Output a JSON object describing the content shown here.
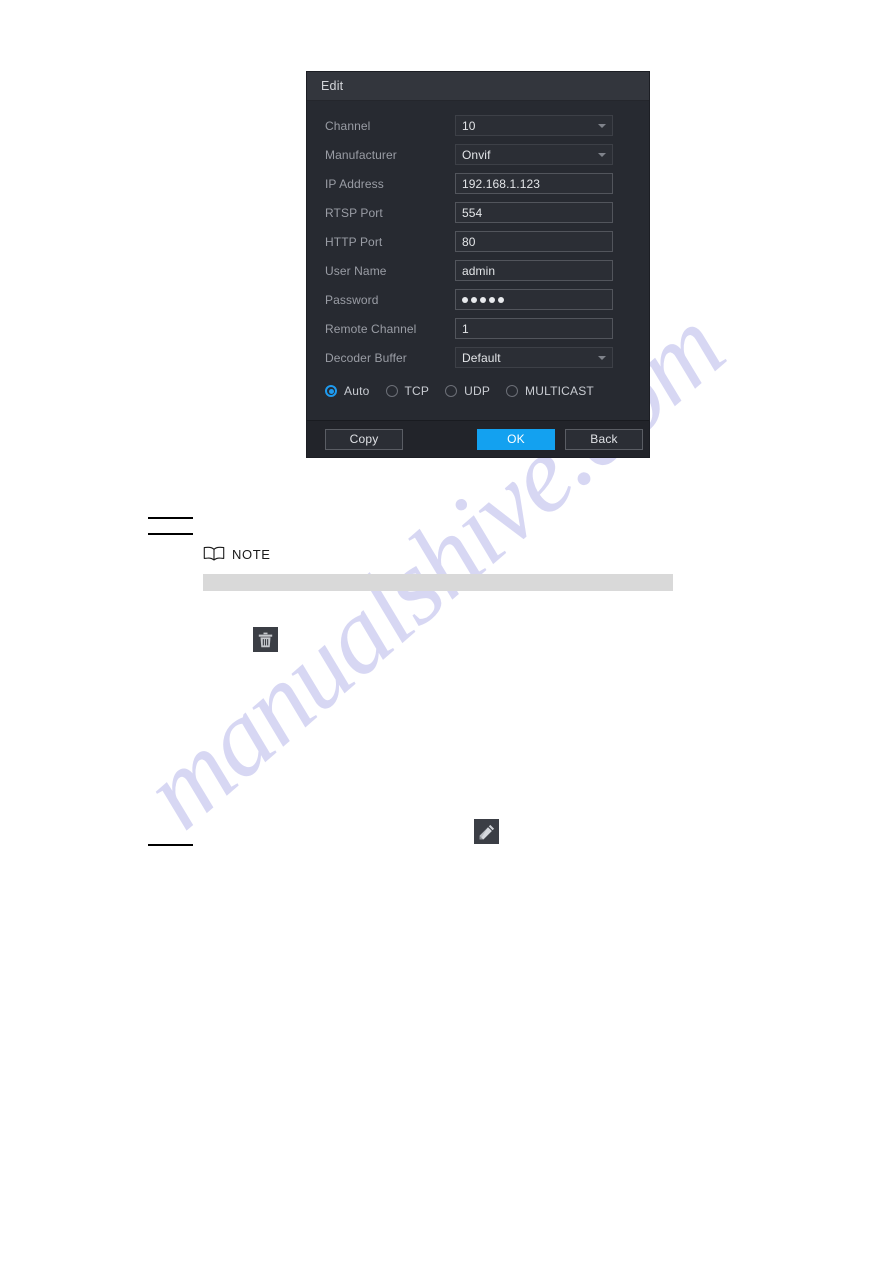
{
  "watermark": {
    "text": "manualshive.com"
  },
  "dialog": {
    "title": "Edit",
    "fields": [
      {
        "label": "Channel",
        "value": "10",
        "type": "select"
      },
      {
        "label": "Manufacturer",
        "value": "Onvif",
        "type": "select"
      },
      {
        "label": "IP Address",
        "value": "192.168.1.123",
        "type": "input"
      },
      {
        "label": "RTSP Port",
        "value": "554",
        "type": "input"
      },
      {
        "label": "HTTP Port",
        "value": "80",
        "type": "input"
      },
      {
        "label": "User Name",
        "value": "admin",
        "type": "input"
      },
      {
        "label": "Password",
        "value": "•••••",
        "type": "password",
        "dots": 5
      },
      {
        "label": "Remote Channel",
        "value": "1",
        "type": "input"
      },
      {
        "label": "Decoder Buffer",
        "value": "Default",
        "type": "select"
      }
    ],
    "protocol": {
      "selected": "Auto",
      "options": [
        "Auto",
        "TCP",
        "UDP",
        "MULTICAST"
      ]
    },
    "buttons": {
      "copy": "Copy",
      "ok": "OK",
      "back": "Back"
    },
    "colors": {
      "accent": "#13a1f0",
      "panel": "#272a31",
      "titlebar": "#33363d",
      "footer": "#22242a",
      "label_text": "#9a9da5",
      "value_text": "#e3e5e8"
    }
  },
  "note": {
    "label": "NOTE",
    "icon": "book-icon"
  },
  "icons": {
    "delete": "trash-icon",
    "edit": "pencil-icon"
  }
}
